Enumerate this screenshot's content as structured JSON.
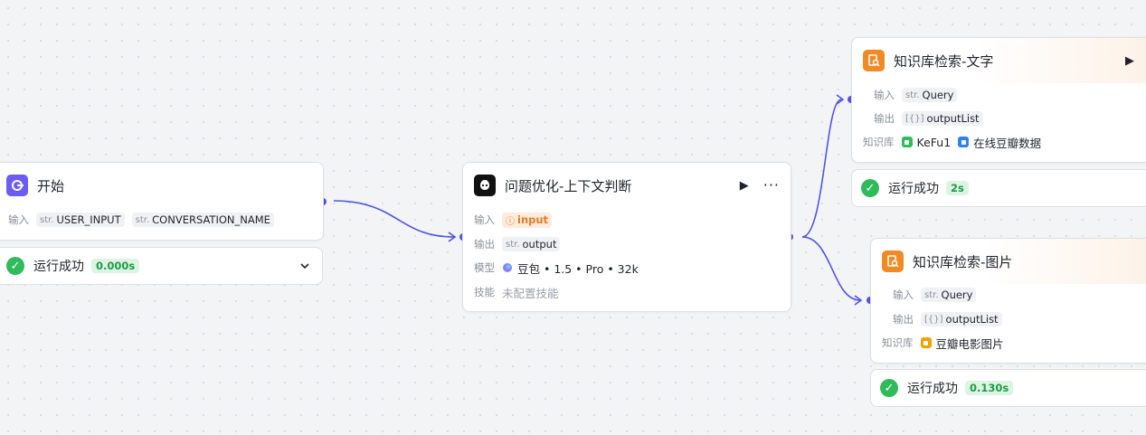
{
  "colors": {
    "edge": "#4e55e0",
    "success": "#2fbb5a",
    "kb_orange": "#f08a24",
    "kb_green": "#2fbb5a",
    "kb_blue": "#2f7ff5",
    "kb_yellow": "#f2a100",
    "start_icon": "#6b5cf6"
  },
  "start_node": {
    "icon": "start-node-icon",
    "title": "开始",
    "input_label": "输入",
    "inputs": [
      {
        "type": "str.",
        "name": "USER_INPUT"
      },
      {
        "type": "str.",
        "name": "CONVERSATION_NAME"
      }
    ],
    "status": {
      "text": "运行成功",
      "time": "0.000s",
      "icon": "check-circle-icon",
      "expand_icon": "chevron-down-icon"
    }
  },
  "llm_node": {
    "icon": "llm-node-icon",
    "title": "问题优化-上下文判断",
    "run_icon": "play-icon",
    "more_icon": "more-icon",
    "input_label": "输入",
    "input": {
      "warn": "ⓘ",
      "name": "input"
    },
    "output_label": "输出",
    "output": {
      "type": "str.",
      "name": "output"
    },
    "model_label": "模型",
    "model": "豆包 • 1.5 • Pro • 32k",
    "skill_label": "技能",
    "skill": "未配置技能"
  },
  "kb_text_node": {
    "icon": "knowledge-search-icon",
    "title": "知识库检索-文字",
    "run_icon": "play-icon",
    "input_label": "输入",
    "input": {
      "type": "str.",
      "name": "Query"
    },
    "output_label": "输出",
    "output": {
      "type": "[{}]",
      "name": "outputList"
    },
    "kb_label": "知识库",
    "kbs": [
      "KeFu1",
      "在线豆瓣数据"
    ],
    "status": {
      "text": "运行成功",
      "time": "2s",
      "icon": "check-circle-icon"
    }
  },
  "kb_image_node": {
    "icon": "knowledge-search-icon",
    "title": "知识库检索-图片",
    "input_label": "输入",
    "input": {
      "type": "str.",
      "name": "Query"
    },
    "output_label": "输出",
    "output": {
      "type": "[{}]",
      "name": "outputList"
    },
    "kb_label": "知识库",
    "kbs": [
      "豆瓣电影图片"
    ],
    "status": {
      "text": "运行成功",
      "time": "0.130s",
      "icon": "check-circle-icon"
    }
  }
}
